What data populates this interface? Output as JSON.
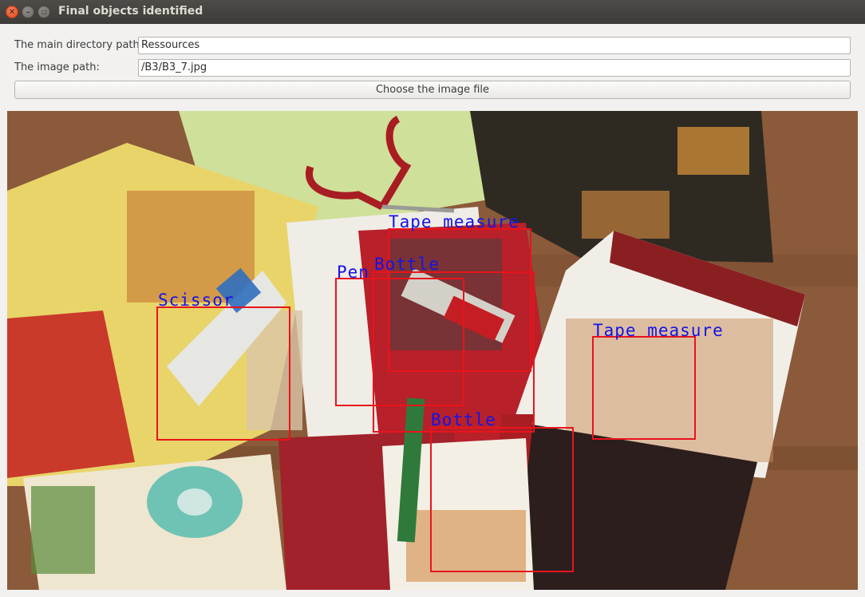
{
  "window": {
    "title": "Final objects identified",
    "close_glyph": "✕",
    "minimize_glyph": "–",
    "maximize_glyph": "▫"
  },
  "form": {
    "directory_label": "The main directory path:",
    "directory_value": "Ressources",
    "image_label": "The image path:",
    "image_value": "/B3/B3_7.jpg",
    "choose_button": "Choose the image file"
  },
  "detections": [
    {
      "label": "Tape measure"
    },
    {
      "label": "Bottle"
    },
    {
      "label": "Pen"
    },
    {
      "label": "Scissor"
    },
    {
      "label": "Tape measure"
    },
    {
      "label": "Bottle"
    }
  ],
  "colors": {
    "box": "#e8141c",
    "label": "#1414e6",
    "titlebar": "#3c3b37"
  }
}
